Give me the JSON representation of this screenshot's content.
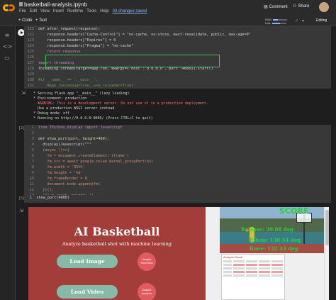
{
  "app": {
    "filename": "basketball-analysis.ipynb",
    "menu": [
      "File",
      "Edit",
      "View",
      "Insert",
      "Runtime",
      "Tools",
      "Help"
    ],
    "saved_status": "All changes saved",
    "comment_label": "Comment",
    "share_label": "Share",
    "add_code": "+ Code",
    "add_text": "+ Text",
    "ram_label": "RAM",
    "disk_label": "Disk",
    "editing_label": "Editing"
  },
  "cell1": {
    "lines": [
      {
        "n": "121",
        "t": "def after_request(response):"
      },
      {
        "n": "122",
        "t": "    response.headers[\"Cache-Control\"] = \"no-cache, no-store, must-revalidate, public, max-age=0\""
      },
      {
        "n": "123",
        "t": "    response.headers[\"Expires\"] = 0"
      },
      {
        "n": "124",
        "t": "    response.headers[\"Pragma\"] = \"no-cache\""
      },
      {
        "n": "125",
        "t": "    return response"
      },
      {
        "n": "126",
        "t": ""
      },
      {
        "n": "127",
        "t": "import threading"
      },
      {
        "n": "128",
        "t": "threading.Thread(target=app.run, kwargs={'host':'0.0.0.0','port':4000}).start()"
      },
      {
        "n": "129",
        "t": ""
      },
      {
        "n": "130",
        "t": "#if __name__ == '__main__':"
      },
      {
        "n": "131",
        "t": "    #app.run(debug=True, use_reloader=True)"
      }
    ],
    "output": [
      " * Serving Flask app \"__main__\" (lazy loading)",
      " * Environment: production",
      "   WARNING: This is a development server. Do not use it in a production deployment.",
      "   Use a production WSGI server instead.",
      " * Debug mode: off",
      " * Running on http://0.0.0.0:4000/ (Press CTRL+C to quit)"
    ]
  },
  "cell2": {
    "exec_count": "[2]",
    "lines": [
      {
        "n": "1",
        "t": "from IPython.display import Javascript"
      },
      {
        "n": "2",
        "t": ""
      },
      {
        "n": "3",
        "t": "def show_port(port, height=400):"
      },
      {
        "n": "4",
        "t": "  display(Javascript(\"\"\""
      },
      {
        "n": "5",
        "t": "  (async ()=>{"
      },
      {
        "n": "6",
        "t": "    fm = document.createElement('iframe')"
      },
      {
        "n": "7",
        "t": "    fm.src = await google.colab.kernel.proxyPort(%s)"
      },
      {
        "n": "8",
        "t": "    fm.width = '95%%'"
      },
      {
        "n": "9",
        "t": "    fm.height = '%d'"
      },
      {
        "n": "10",
        "t": "    fm.frameBorder = 0"
      },
      {
        "n": "11",
        "t": "    document.body.append(fm)"
      },
      {
        "n": "12",
        "t": "  })();"
      },
      {
        "n": "13",
        "t": "  \"\"\" % (port, height) ))"
      }
    ]
  },
  "cell3": {
    "exec_count": "[5]",
    "code": "1  show_port(4000)"
  },
  "webapp": {
    "title": "AI Basketball",
    "subtitle": "Analyze basketball shot with machine learning",
    "load_image": "Load Image",
    "load_video": "Load Video",
    "sample_detection": "Sample Detection",
    "sample_analysis": "Sample Analysis",
    "score_label": "SCORE",
    "release_text": "Release: 39.08 deg",
    "elbow_text": "Elbow: 130.54 deg",
    "knee_text": "Knee: 132.44 deg",
    "analysis_result": "Analysis Result"
  }
}
